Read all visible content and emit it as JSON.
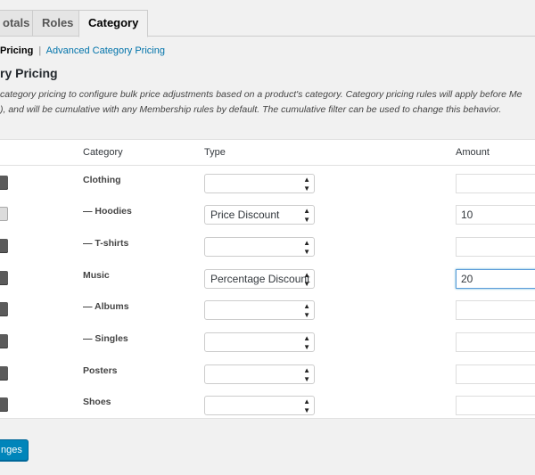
{
  "tabs": [
    {
      "label": "otals",
      "active": false
    },
    {
      "label": "Roles",
      "active": false
    },
    {
      "label": "Category",
      "active": true
    }
  ],
  "subsubsub": {
    "current": "Pricing",
    "separator": "|",
    "link": "Advanced Category Pricing"
  },
  "section_title": "ry Pricing",
  "description": [
    "category pricing to configure bulk price adjustments based on a product's category. Category pricing rules will apply before Me",
    "), and will be cumulative with any Membership rules by default. The cumulative filter can be used to change this behavior."
  ],
  "table": {
    "headers": {
      "category": "Category",
      "type": "Type",
      "amount": "Amount"
    },
    "rows": [
      {
        "category": "Clothing",
        "type": "",
        "amount": ""
      },
      {
        "category": "— Hoodies",
        "type": "Price Discount",
        "amount": "10"
      },
      {
        "category": "— T-shirts",
        "type": "",
        "amount": ""
      },
      {
        "category": "Music",
        "type": "Percentage Discount",
        "amount": "20"
      },
      {
        "category": "— Albums",
        "type": "",
        "amount": ""
      },
      {
        "category": "— Singles",
        "type": "",
        "amount": ""
      },
      {
        "category": "Posters",
        "type": "",
        "amount": ""
      },
      {
        "category": "Shoes",
        "type": "",
        "amount": ""
      }
    ]
  },
  "save_button": {
    "label": "nges"
  },
  "colors": {
    "accent": "#0073aa",
    "button": "#0085ba",
    "focus": "#5b9dd9"
  },
  "icons": {
    "select_arrows": "up-down-arrows-icon",
    "drag_handle": "drag-handle-icon"
  }
}
